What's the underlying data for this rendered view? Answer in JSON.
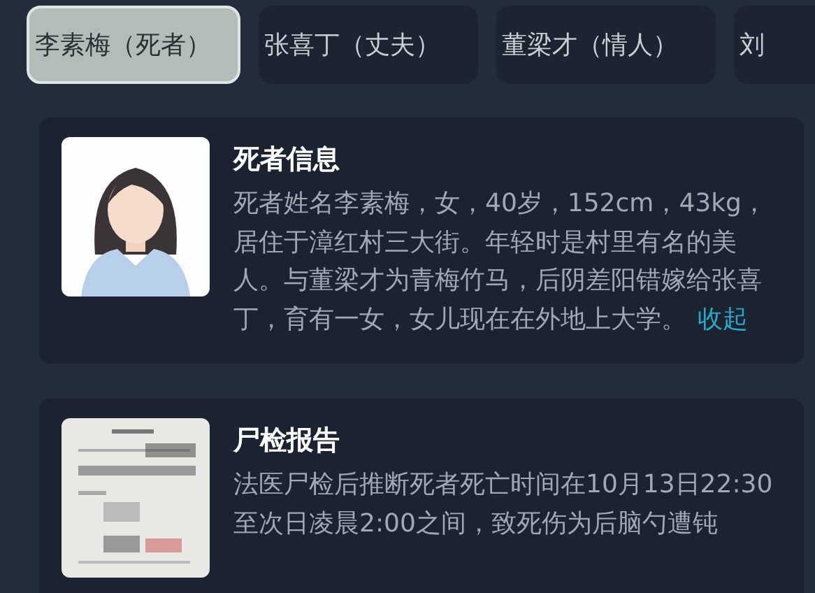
{
  "tabs": [
    {
      "label": "李素梅（死者）",
      "selected": true
    },
    {
      "label": "张喜丁（丈夫）",
      "selected": false
    },
    {
      "label": "董梁才（情人）",
      "selected": false
    },
    {
      "label": "刘",
      "selected": false
    }
  ],
  "cards": [
    {
      "kind": "avatar",
      "title": "死者信息",
      "body": "死者姓名李素梅，女，40岁，152cm，43kg，居住于漳红村三大街。年轻时是村里有名的美人。与董梁才为青梅竹马，后阴差阳错嫁给张喜丁，育有一女，女儿现在在外地上大学。",
      "link": "收起"
    },
    {
      "kind": "picture",
      "title": "尸检报告",
      "body": "法医尸检后推断死者死亡时间在10月13日22:30至次日凌晨2:00之间，致死伤为后脑勺遭钝"
    }
  ]
}
